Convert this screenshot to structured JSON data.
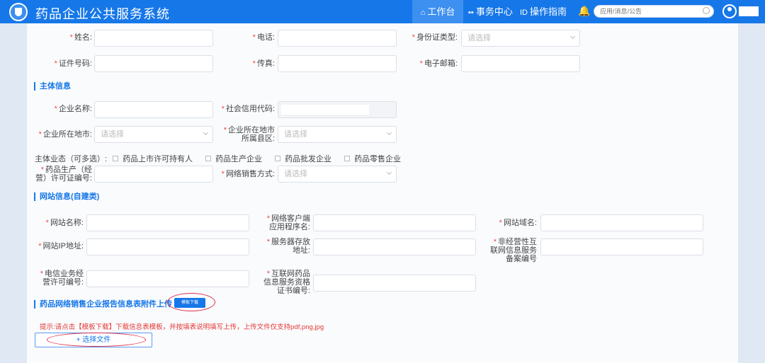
{
  "header": {
    "title": "药品企业公共服务系统",
    "nav": [
      {
        "label": "工作台",
        "icon": "home-icon",
        "active": true
      },
      {
        "label": "事务中心",
        "icon": "grid-icon",
        "active": false
      },
      {
        "label": "操作指南",
        "icon": "id-card-icon",
        "active": false
      }
    ],
    "search_placeholder": "应用/消息/公告"
  },
  "form": {
    "name": {
      "label": "姓名:"
    },
    "phone": {
      "label": "电话:"
    },
    "id_type": {
      "label": "身份证类型:",
      "placeholder": "请选择"
    },
    "id_number": {
      "label": "证件号码:"
    },
    "fax": {
      "label": "传真:"
    },
    "email": {
      "label": "电子邮箱:"
    }
  },
  "subject": {
    "section_title": "主体信息",
    "company_name": {
      "label": "企业名称:"
    },
    "credit_code": {
      "label": "社会信用代码:"
    },
    "city": {
      "label": "企业所在地市:",
      "placeholder": "请选择"
    },
    "county": {
      "label1": "企业所在地市",
      "label2": "所属县区:",
      "placeholder": "请选择"
    },
    "business_type": {
      "label": "主体业态（可多选）:",
      "options": [
        "药品上市许可持有人",
        "药品生产企业",
        "药品批发企业",
        "药品零售企业"
      ]
    },
    "license": {
      "label1": "药品生产（经",
      "label2": "营）许可证编号:"
    },
    "sales_mode": {
      "label": "网络销售方式:",
      "placeholder": "请选择"
    }
  },
  "website": {
    "section_title": "网站信息(自建类)",
    "site_name": {
      "label": "网站名称:"
    },
    "client_name": {
      "label1": "网络客户端",
      "label2": "应用程序名:"
    },
    "domain": {
      "label": "网站域名:"
    },
    "ip": {
      "label": "网站IP地址:"
    },
    "server": {
      "label1": "服务器存放",
      "label2": "地址:"
    },
    "icp": {
      "label1": "非经营性互",
      "label2": "联网信息服务",
      "label3": "备案编号"
    },
    "telecom": {
      "label1": "电信业务经",
      "label2": "营许可编号:"
    },
    "drug_info": {
      "label1": "互联网药品",
      "label2": "信息服务资格",
      "label3": "证书编号:"
    }
  },
  "upload": {
    "section_title": "药品网络销售企业报告信息表附件上传",
    "template_button": "模板下载",
    "hint": "提示:请点击【模板下载】下载信息表模板，并按填表说明填写上传，上传文件仅支持pdf,png,jpg",
    "choose_file": "+ 选择文件"
  },
  "colors": {
    "primary": "#1677e8",
    "required": "#f04b4b",
    "annotation": "#e0304a"
  }
}
